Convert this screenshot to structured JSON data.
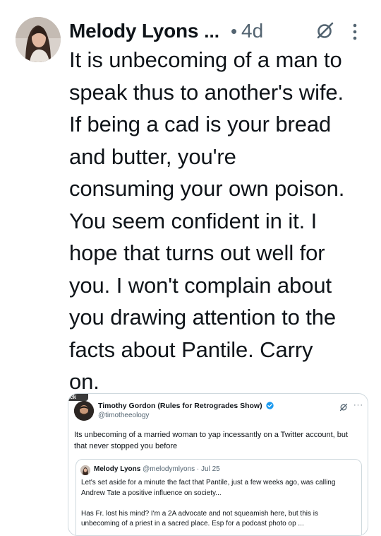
{
  "tweet": {
    "display_name": "Melody Lyons",
    "name_ellipsis": "...",
    "dot": "•",
    "time": "4d",
    "text": "It is unbecoming of a man to\nspeak thus to another's wife.\nIf being a cad is your bread\nand butter, you're\nconsuming your own poison.\nYou seem confident in it. I\nhope that turns out well for\nyou. I won't complain about\nyou drawing attention to the\nfacts about Pantile. Carry\non."
  },
  "embedded": {
    "back_label": "ck",
    "name": "Timothy Gordon (Rules for Retrogrades Show)",
    "handle": "@timotheeology",
    "more": "···",
    "text": "Its unbecoming of a married woman to yap incessantly on a Twitter account, but that never stopped you before",
    "quote": {
      "name": "Melody Lyons",
      "meta": "@melodymlyons · Jul 25",
      "para1": "Let's set aside for a minute the fact that Pantile, just a few weeks ago, was calling Andrew Tate a positive influence on society...",
      "para2": "Has Fr. lost his mind? I'm a 2A advocate and not squeamish here, but this is unbecoming of a priest in a sacred place. Esp for a podcast photo op ..."
    }
  },
  "colors": {
    "text_primary": "#0f1419",
    "text_secondary": "#536471",
    "border": "#cfd9de",
    "verified": "#1d9bf0"
  },
  "icons": [
    "avatar",
    "grok-icon",
    "more-icon",
    "verified-icon"
  ]
}
